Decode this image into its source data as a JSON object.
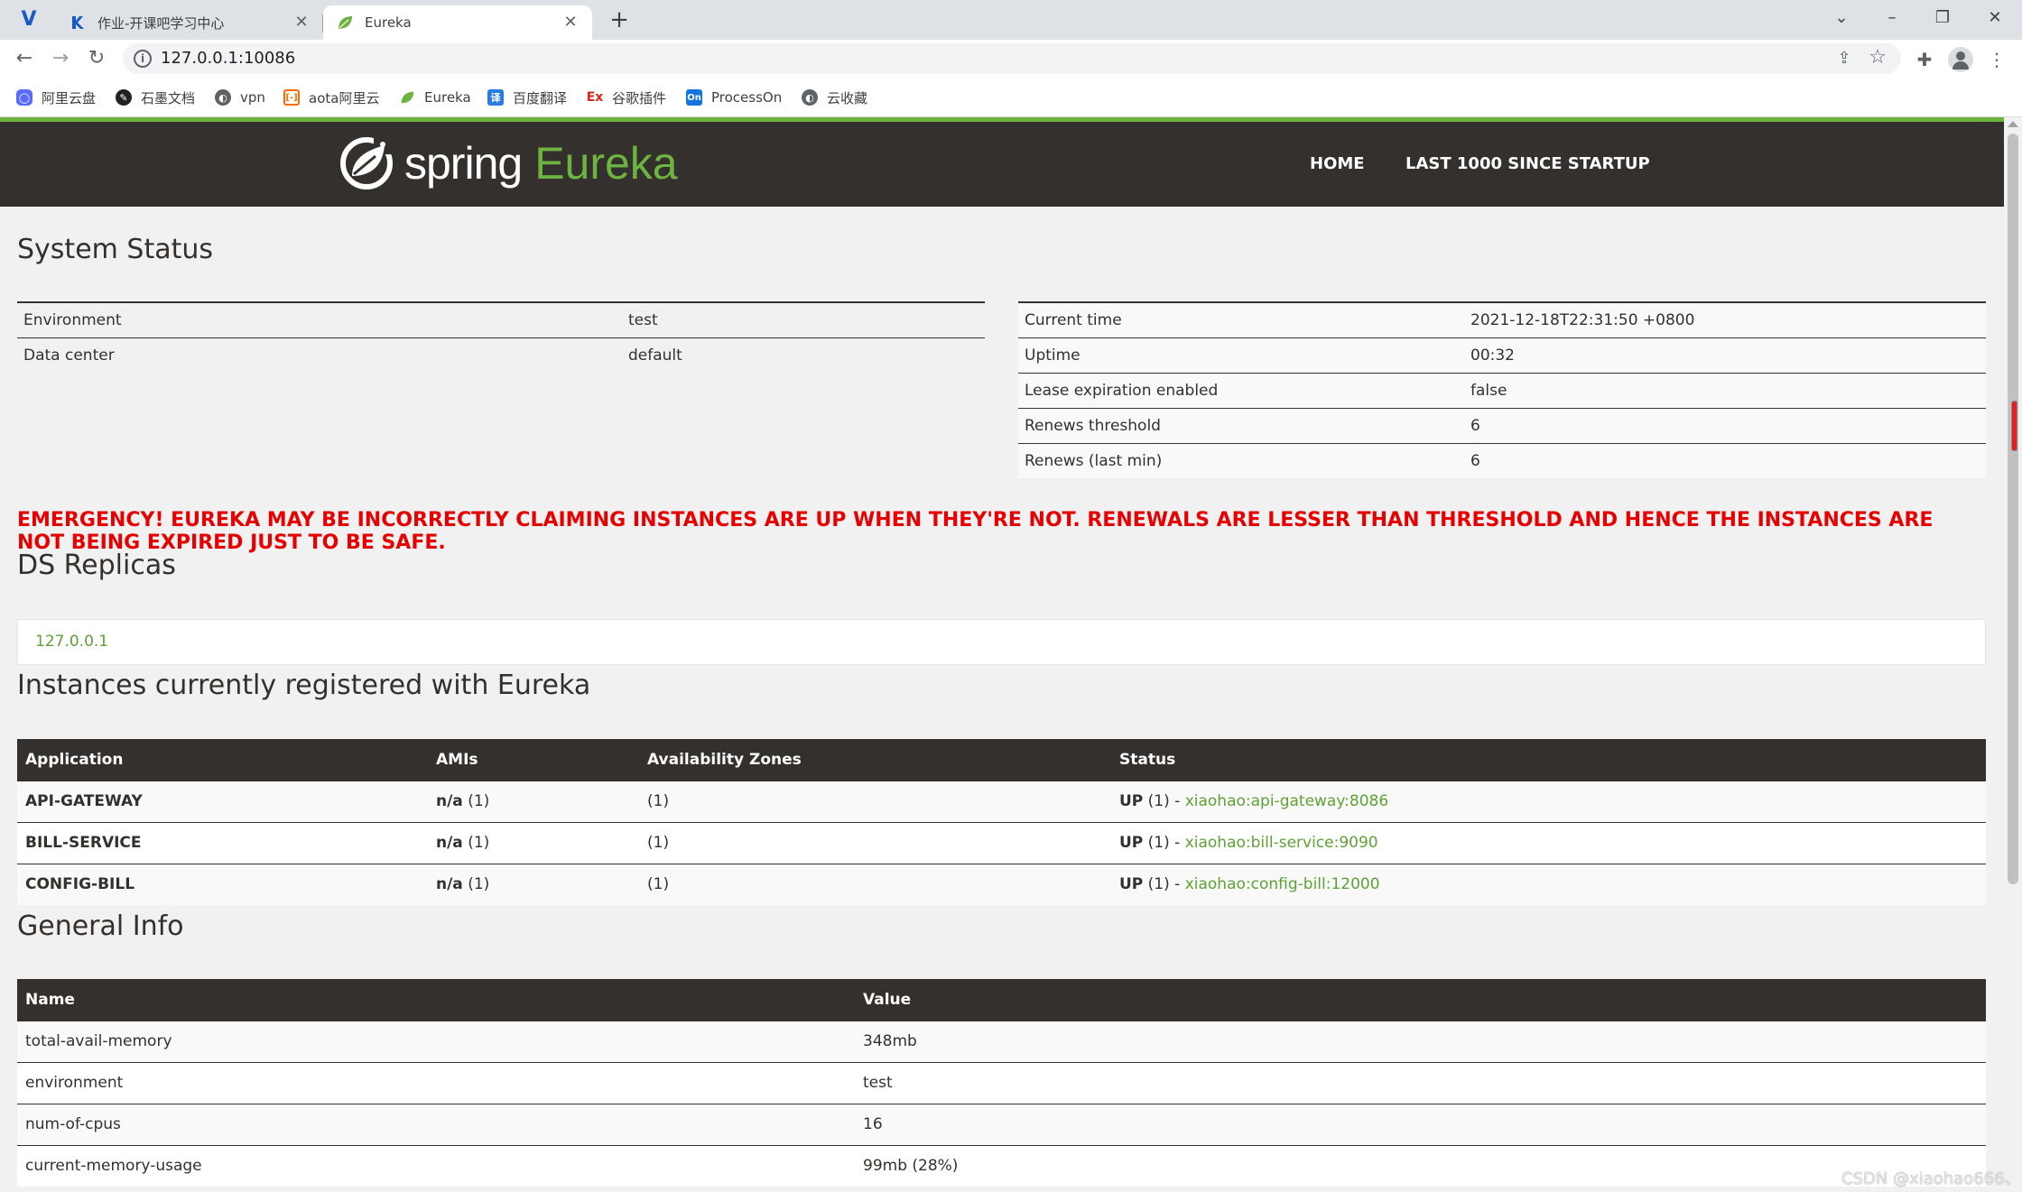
{
  "browser": {
    "tabs": [
      {
        "title": "作业-开课吧学习中心",
        "active": false
      },
      {
        "title": "Eureka",
        "active": true
      }
    ],
    "url": "127.0.0.1:10086",
    "bookmarks": [
      {
        "label": "阿里云盘",
        "icon": "aliyun-drive-icon",
        "color": "#5a6cff"
      },
      {
        "label": "石墨文档",
        "icon": "shimo-icon",
        "color": "#222222"
      },
      {
        "label": "vpn",
        "icon": "globe-icon",
        "color": "#5f6368"
      },
      {
        "label": "aota阿里云",
        "icon": "aliyun-icon",
        "color": "#ff6a00"
      },
      {
        "label": "Eureka",
        "icon": "spring-leaf-icon",
        "color": "#6db33f"
      },
      {
        "label": "百度翻译",
        "icon": "baidu-translate-icon",
        "color": "#2b7be4"
      },
      {
        "label": "谷歌插件",
        "icon": "ex-icon",
        "color": "#e2231a"
      },
      {
        "label": "ProcessOn",
        "icon": "processon-icon",
        "color": "#1475e1"
      },
      {
        "label": "云收藏",
        "icon": "globe-icon",
        "color": "#5f6368"
      }
    ]
  },
  "header": {
    "logo_spring": "spring",
    "logo_eureka": "Eureka",
    "nav": [
      "HOME",
      "LAST 1000 SINCE STARTUP"
    ]
  },
  "system_status": {
    "title": "System Status",
    "left": [
      {
        "name": "Environment",
        "value": "test"
      },
      {
        "name": "Data center",
        "value": "default"
      }
    ],
    "right": [
      {
        "name": "Current time",
        "value": "2021-12-18T22:31:50 +0800"
      },
      {
        "name": "Uptime",
        "value": "00:32"
      },
      {
        "name": "Lease expiration enabled",
        "value": "false"
      },
      {
        "name": "Renews threshold",
        "value": "6"
      },
      {
        "name": "Renews (last min)",
        "value": "6"
      }
    ]
  },
  "emergency": "EMERGENCY! EUREKA MAY BE INCORRECTLY CLAIMING INSTANCES ARE UP WHEN THEY'RE NOT. RENEWALS ARE LESSER THAN THRESHOLD AND HENCE THE INSTANCES ARE NOT BEING EXPIRED JUST TO BE SAFE.",
  "ds_replicas": {
    "title": "DS Replicas",
    "items": [
      "127.0.0.1"
    ]
  },
  "instances": {
    "title": "Instances currently registered with Eureka",
    "columns": [
      "Application",
      "AMIs",
      "Availability Zones",
      "Status"
    ],
    "rows": [
      {
        "app": "API-GATEWAY",
        "ami_label": "n/a",
        "ami_count": "(1)",
        "zones": "(1)",
        "status": "UP",
        "status_count": "(1) -",
        "link": "xiaohao:api-gateway:8086"
      },
      {
        "app": "BILL-SERVICE",
        "ami_label": "n/a",
        "ami_count": "(1)",
        "zones": "(1)",
        "status": "UP",
        "status_count": "(1) -",
        "link": "xiaohao:bill-service:9090"
      },
      {
        "app": "CONFIG-BILL",
        "ami_label": "n/a",
        "ami_count": "(1)",
        "zones": "(1)",
        "status": "UP",
        "status_count": "(1) -",
        "link": "xiaohao:config-bill:12000"
      }
    ]
  },
  "general_info": {
    "title": "General Info",
    "columns": [
      "Name",
      "Value"
    ],
    "rows": [
      {
        "name": "total-avail-memory",
        "value": "348mb"
      },
      {
        "name": "environment",
        "value": "test"
      },
      {
        "name": "num-of-cpus",
        "value": "16"
      },
      {
        "name": "current-memory-usage",
        "value": "99mb (28%)"
      }
    ]
  },
  "watermark": "CSDN @xiaohao666、",
  "colors": {
    "spring_green": "#6db33f",
    "navbar": "#34302d",
    "emergency": "#e80000",
    "link": "#5fa134"
  }
}
